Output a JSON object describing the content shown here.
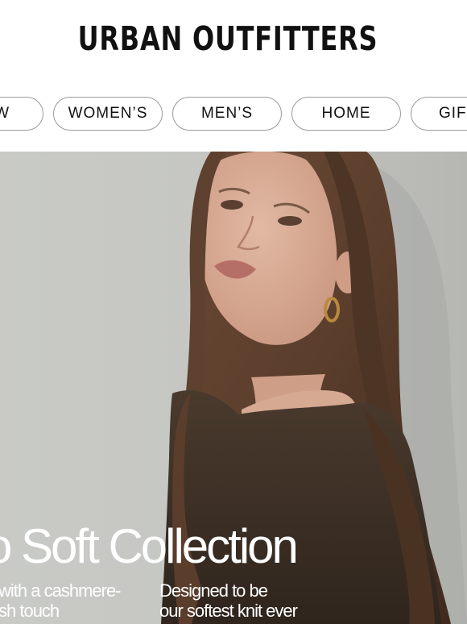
{
  "header": {
    "logo": "URBAN OUTFITTERS"
  },
  "nav": {
    "items": [
      {
        "label": "W"
      },
      {
        "label": "WOMEN’S"
      },
      {
        "label": "MEN’S"
      },
      {
        "label": "HOME"
      },
      {
        "label": "GIF"
      }
    ]
  },
  "hero": {
    "title": "o Soft Collection",
    "left_line1": "with a cashmere-",
    "left_line2": "sh touch",
    "right_line1": "Designed to be",
    "right_line2": "our  softest knit ever"
  }
}
